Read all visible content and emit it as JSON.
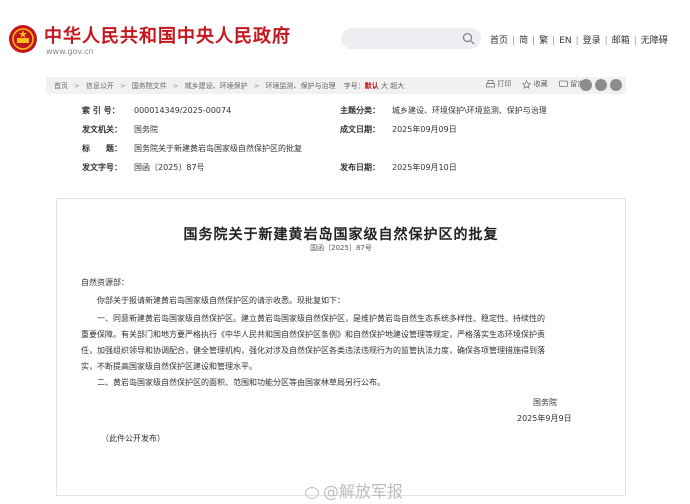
{
  "header": {
    "site_title": "中华人民共和国中央人民政府",
    "site_url": "www.gov.cn",
    "nav": [
      "首页",
      "简",
      "繁",
      "EN",
      "登录",
      "邮箱",
      "无障碍"
    ]
  },
  "breadcrumb": {
    "items": [
      "首页",
      "信息公开",
      "国务院文件",
      "城乡建设、环境保护",
      "环境监测、保护与治理"
    ],
    "font_label": "字号：",
    "font_sizes": [
      "默认",
      "大",
      "超大"
    ],
    "tools": [
      "打印",
      "收藏",
      "留言"
    ]
  },
  "meta": {
    "index_key": "索 引 号：",
    "index_val": "000014349/2025-00074",
    "category_key": "主题分类：",
    "category_val": "城乡建设、环境保护\\环境监测、保护与治理",
    "issuer_key": "发文机关：",
    "issuer_val": "国务院",
    "date_written_key": "成文日期：",
    "date_written_val": "2025年09月09日",
    "title_key": "标　　题：",
    "title_val": "国务院关于新建黄岩岛国家级自然保护区的批复",
    "docno_key": "发文字号：",
    "docno_val": "国函〔2025〕87号",
    "publish_key": "发布日期：",
    "publish_val": "2025年09月10日"
  },
  "article": {
    "title": "国务院关于新建黄岩岛国家级自然保护区的批复",
    "docno": "国函〔2025〕87号",
    "salutation": "自然资源部：",
    "p1": "你部关于报请新建黄岩岛国家级自然保护区的请示收悉。现批复如下：",
    "p2_l1": "一、同意新建黄岩岛国家级自然保护区。建立黄岩岛国家级自然保护区，是维护黄岩岛自然生态系统多样性、稳定性、持续性的",
    "p2_l2": "重要保障。有关部门和地方要严格执行《中华人民共和国自然保护区条例》和自然保护地建设管理等规定，严格落实生态环境保护责",
    "p2_l3": "任，加强组织领导和协调配合，健全管理机构，强化对涉及自然保护区各类违法违规行为的监管执法力度，确保各项管理措施得到落",
    "p2_l4": "实，不断提高国家级自然保护区建设和管理水平。",
    "p3": "二、黄岩岛国家级自然保护区的面积、范围和功能分区等由国家林草局另行公布。",
    "signer": "国务院",
    "sign_date": "2025年9月9日",
    "note": "（此件公开发布）"
  },
  "watermark": "@解放军报"
}
